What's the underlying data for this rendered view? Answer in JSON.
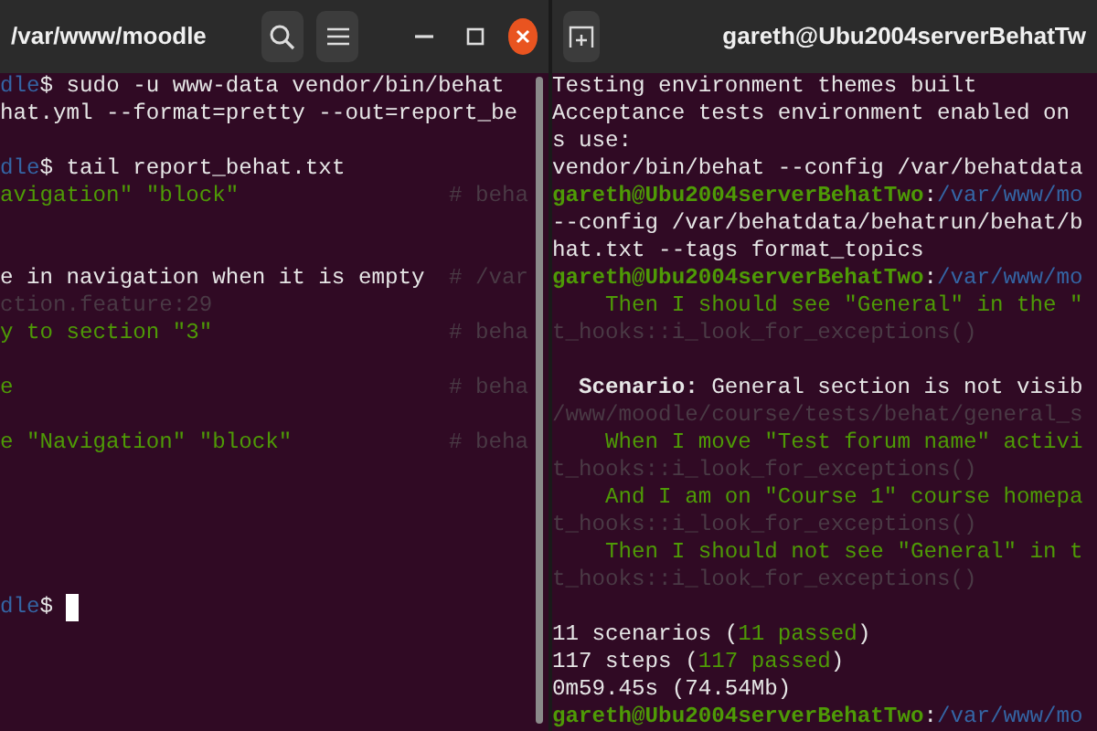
{
  "windows": [
    {
      "title": "/var/www/moodle",
      "controls": [
        {
          "kind": "search"
        },
        {
          "kind": "menu"
        },
        {
          "kind": "minimize"
        },
        {
          "kind": "maximize"
        },
        {
          "kind": "close"
        }
      ],
      "cursor": true,
      "scrollbar": true,
      "lines": [
        {
          "segments": [
            {
              "kind": "path",
              "text": "dle"
            },
            {
              "kind": "plain",
              "text": "$ sudo -u www-data vendor/bin/behat"
            }
          ]
        },
        {
          "segments": [
            {
              "kind": "plain",
              "text": "hat.yml --format=pretty --out=report_be"
            }
          ]
        },
        {
          "kind": "blank"
        },
        {
          "segments": [
            {
              "kind": "path",
              "text": "dle"
            },
            {
              "kind": "plain",
              "text": "$ tail report_behat.txt"
            }
          ]
        },
        {
          "segments": [
            {
              "kind": "step",
              "text": "avigation\" \"block\""
            },
            {
              "kind": "comment",
              "text": "# beha"
            }
          ]
        },
        {
          "kind": "blank"
        },
        {
          "kind": "blank"
        },
        {
          "segments": [
            {
              "kind": "plain",
              "text": "e in navigation when it is empty "
            },
            {
              "kind": "comment",
              "text": "# /var"
            }
          ]
        },
        {
          "segments": [
            {
              "kind": "dim",
              "text": "ction.feature:29"
            }
          ]
        },
        {
          "segments": [
            {
              "kind": "step",
              "text": "y to section \"3\""
            },
            {
              "kind": "comment",
              "text": "# beha"
            }
          ]
        },
        {
          "kind": "blank"
        },
        {
          "segments": [
            {
              "kind": "step",
              "text": "e"
            },
            {
              "kind": "comment",
              "text": "# beha"
            }
          ]
        },
        {
          "kind": "blank"
        },
        {
          "segments": [
            {
              "kind": "step",
              "text": "e \"Navigation\" \"block\""
            },
            {
              "kind": "comment",
              "text": "# beha"
            }
          ]
        },
        {
          "kind": "blank"
        },
        {
          "kind": "blank"
        },
        {
          "kind": "blank"
        },
        {
          "kind": "blank"
        },
        {
          "kind": "blank"
        },
        {
          "segments": [
            {
              "kind": "path",
              "text": "dle"
            },
            {
              "kind": "plain",
              "text": "$"
            }
          ]
        }
      ]
    },
    {
      "title": "gareth@Ubu2004serverBehatTw",
      "controls": [
        {
          "kind": "new-tab"
        }
      ],
      "cursor": false,
      "scrollbar": false,
      "lines": [
        {
          "segments": [
            {
              "kind": "plain",
              "text": "Testing environment themes built"
            }
          ]
        },
        {
          "segments": [
            {
              "kind": "plain",
              "text": "Acceptance tests environment enabled on"
            }
          ]
        },
        {
          "segments": [
            {
              "kind": "plain",
              "text": "s use:"
            }
          ]
        },
        {
          "segments": [
            {
              "kind": "plain",
              "text": "vendor/bin/behat --config /var/behatdata"
            }
          ]
        },
        {
          "segments": [
            {
              "kind": "user",
              "text": "gareth@Ubu2004serverBehatTwo"
            },
            {
              "kind": "plain",
              "text": ":"
            },
            {
              "kind": "path",
              "text": "/var/www/mo"
            }
          ]
        },
        {
          "segments": [
            {
              "kind": "plain",
              "text": "--config /var/behatdata/behatrun/behat/b"
            }
          ]
        },
        {
          "segments": [
            {
              "kind": "plain",
              "text": "hat.txt --tags format_topics"
            }
          ]
        },
        {
          "segments": [
            {
              "kind": "user",
              "text": "gareth@Ubu2004serverBehatTwo"
            },
            {
              "kind": "plain",
              "text": ":"
            },
            {
              "kind": "path",
              "text": "/var/www/mo"
            }
          ]
        },
        {
          "segments": [
            {
              "kind": "step",
              "text": "    Then I should see \"General\" in the \""
            }
          ]
        },
        {
          "segments": [
            {
              "kind": "dim",
              "text": "t_hooks::i_look_for_exceptions()"
            }
          ]
        },
        {
          "kind": "blank"
        },
        {
          "segments": [
            {
              "kind": "bold",
              "text": "  Scenario:"
            },
            {
              "kind": "plain",
              "text": " General section is not visib"
            }
          ]
        },
        {
          "segments": [
            {
              "kind": "dim",
              "text": "/www/moodle/course/tests/behat/general_s"
            }
          ]
        },
        {
          "segments": [
            {
              "kind": "step",
              "text": "    When I move \"Test forum name\" activi"
            }
          ]
        },
        {
          "segments": [
            {
              "kind": "dim",
              "text": "t_hooks::i_look_for_exceptions()"
            }
          ]
        },
        {
          "segments": [
            {
              "kind": "step",
              "text": "    And I am on \"Course 1\" course homepa"
            }
          ]
        },
        {
          "segments": [
            {
              "kind": "dim",
              "text": "t_hooks::i_look_for_exceptions()"
            }
          ]
        },
        {
          "segments": [
            {
              "kind": "step",
              "text": "    Then I should not see \"General\" in t"
            }
          ]
        },
        {
          "segments": [
            {
              "kind": "dim",
              "text": "t_hooks::i_look_for_exceptions()"
            }
          ]
        },
        {
          "kind": "blank"
        },
        {
          "segments": [
            {
              "kind": "plain",
              "text": "11 scenarios ("
            },
            {
              "kind": "step",
              "text": "11 passed"
            },
            {
              "kind": "plain",
              "text": ")"
            }
          ]
        },
        {
          "segments": [
            {
              "kind": "plain",
              "text": "117 steps ("
            },
            {
              "kind": "step",
              "text": "117 passed"
            },
            {
              "kind": "plain",
              "text": ")"
            }
          ]
        },
        {
          "segments": [
            {
              "kind": "plain",
              "text": "0m59.45s (74.54Mb)"
            }
          ]
        },
        {
          "segments": [
            {
              "kind": "user",
              "text": "gareth@Ubu2004serverBehatTwo"
            },
            {
              "kind": "plain",
              "text": ":"
            },
            {
              "kind": "path",
              "text": "/var/www/mo"
            }
          ]
        }
      ]
    }
  ]
}
